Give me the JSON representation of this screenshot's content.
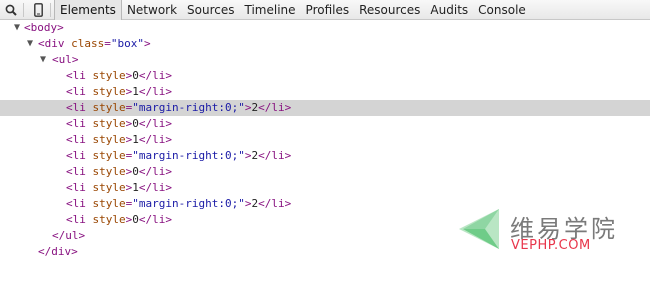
{
  "toolbar": {
    "search_icon": "search-icon",
    "device_icon": "device-mode-icon",
    "tabs": [
      {
        "label": "Elements",
        "active": true
      },
      {
        "label": "Network",
        "active": false
      },
      {
        "label": "Sources",
        "active": false
      },
      {
        "label": "Timeline",
        "active": false
      },
      {
        "label": "Profiles",
        "active": false
      },
      {
        "label": "Resources",
        "active": false
      },
      {
        "label": "Audits",
        "active": false
      },
      {
        "label": "Console",
        "active": false
      }
    ]
  },
  "dom": {
    "body_open": "<body>",
    "div_open_tag": "<div",
    "div_attr_name": "class",
    "div_attr_eq": "=",
    "div_attr_value": "\"box\"",
    "div_open_end": ">",
    "ul_open": "<ul>",
    "li_open_tag": "<li",
    "li_attr_name": "style",
    "li_attr_eq": "=",
    "li_margin_value": "\"margin-right:0;\"",
    "li_open_end": ">",
    "li_close": "</li>",
    "items": [
      {
        "has_value": false,
        "text": "0"
      },
      {
        "has_value": false,
        "text": "1"
      },
      {
        "has_value": true,
        "text": "2",
        "selected": true
      },
      {
        "has_value": false,
        "text": "0"
      },
      {
        "has_value": false,
        "text": "1"
      },
      {
        "has_value": true,
        "text": "2"
      },
      {
        "has_value": false,
        "text": "0"
      },
      {
        "has_value": false,
        "text": "1"
      },
      {
        "has_value": true,
        "text": "2"
      },
      {
        "has_value": false,
        "text": "0"
      }
    ],
    "ul_close": "</ul>",
    "div_close": "</div>"
  },
  "colors": {
    "tag": "#881280",
    "attribute_name": "#994500",
    "attribute_value": "#1a1aa6",
    "selection": "#d4d4d4"
  },
  "watermark": {
    "logo_icon": "vephp-logo-icon",
    "chinese": "维易学院",
    "domain": "VEPHP.COM"
  }
}
